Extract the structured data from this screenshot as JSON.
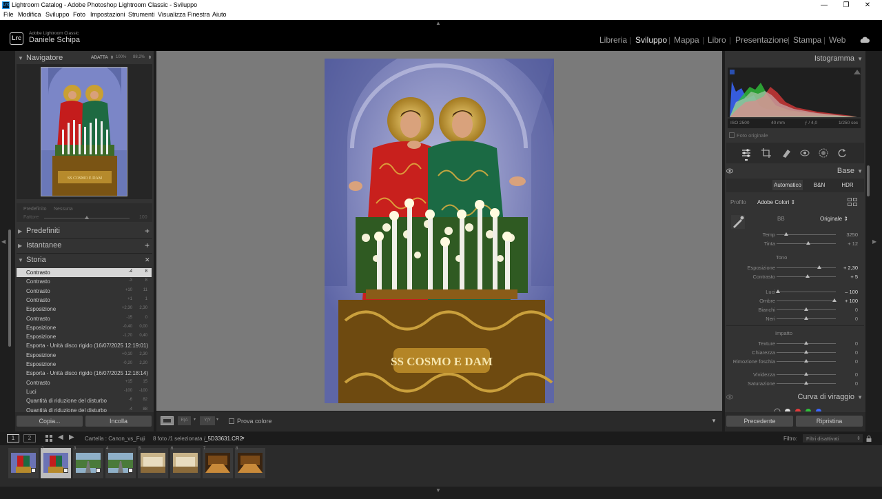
{
  "window": {
    "title": "Lightroom Catalog - Adobe Photoshop Lightroom Classic - Sviluppo",
    "app_icon": "Lrc",
    "controls": {
      "minimize": "—",
      "maximize": "❐",
      "close": "✕"
    }
  },
  "menu": [
    "File",
    "Modifica",
    "Sviluppo",
    "Foto",
    "Impostazioni",
    "Strumenti",
    "Visualizza",
    "Finestra",
    "Aiuto"
  ],
  "identity": {
    "logo": "Lrc",
    "product": "Adobe Lightroom Classic",
    "user": "Daniele Schipa"
  },
  "modules": [
    {
      "label": "Libreria",
      "active": false
    },
    {
      "label": "Sviluppo",
      "active": true
    },
    {
      "label": "Mappa",
      "active": false
    },
    {
      "label": "Libro",
      "active": false
    },
    {
      "label": "Presentazione",
      "active": false
    },
    {
      "label": "Stampa",
      "active": false
    },
    {
      "label": "Web",
      "active": false
    }
  ],
  "navigator": {
    "title": "Navigatore",
    "fit": "ADATTA",
    "z1": "100%",
    "z2": "88,2%"
  },
  "preset_amount": {
    "label": "Predefinito",
    "value": "Nessuna",
    "amount_label": "Fattore",
    "amount_value": "100",
    "amount": 0.5
  },
  "left_sections": {
    "presets": "Predefiniti",
    "snapshots": "Istantanee",
    "history": "Storia",
    "add": "+",
    "clear": "✕"
  },
  "history": [
    {
      "name": "Contrasto",
      "v1": "-4",
      "v2": "8",
      "selected": true
    },
    {
      "name": "Contrasto",
      "v1": "-3",
      "v2": "8"
    },
    {
      "name": "Contrasto",
      "v1": "+10",
      "v2": "11"
    },
    {
      "name": "Contrasto",
      "v1": "+1",
      "v2": "1"
    },
    {
      "name": "Esposizione",
      "v1": "+2,30",
      "v2": "2,30"
    },
    {
      "name": "Contrasto",
      "v1": "-15",
      "v2": "0"
    },
    {
      "name": "Esposizione",
      "v1": "-0,40",
      "v2": "0,00"
    },
    {
      "name": "Esposizione",
      "v1": "-1,70",
      "v2": "0,40"
    },
    {
      "name": "Esporta - Unità disco rigido (16/07/2025 12:19:01)",
      "v1": "",
      "v2": ""
    },
    {
      "name": "Esposizione",
      "v1": "+0,10",
      "v2": "2,30"
    },
    {
      "name": "Esposizione",
      "v1": "-0,20",
      "v2": "2,20"
    },
    {
      "name": "Esporta - Unità disco rigido (16/07/2025 12:18:14)",
      "v1": "",
      "v2": ""
    },
    {
      "name": "Contrasto",
      "v1": "+15",
      "v2": "15"
    },
    {
      "name": "Luci",
      "v1": "-100",
      "v2": "-100"
    },
    {
      "name": "Quantità di riduzione del disturbo",
      "v1": "-6",
      "v2": "82"
    },
    {
      "name": "Quantità di riduzione del disturbo",
      "v1": "-4",
      "v2": "88"
    }
  ],
  "left_buttons": {
    "copy": "Copia...",
    "paste": "Incolla"
  },
  "toolbar": {
    "soft_proof": "Prova colore",
    "view_ba": "R|A",
    "view_yy": "Y|Y"
  },
  "histogram": {
    "title": "Istogramma",
    "iso": "ISO 2500",
    "focal": "40 mm",
    "aperture": "ƒ / 4,0",
    "shutter": "1/250 sec",
    "original": "Foto originale"
  },
  "tools": [
    "sliders-icon",
    "crop-icon",
    "heal-icon",
    "redeye-icon",
    "mask-icon",
    "reset-icon"
  ],
  "base": {
    "title": "Base",
    "treatments": [
      "Automatico",
      "B&N",
      "HDR"
    ],
    "profile_label": "Profilo",
    "profile_value": "Adobe Colori ⇕",
    "wb_label": "BB",
    "wb_value": "Originale ⇕",
    "tone_label": "Tono",
    "presence_label": "Impatto"
  },
  "sliders_wb": [
    {
      "label": "Temp",
      "value": "3250",
      "pos": 0.16,
      "bright": false
    },
    {
      "label": "Tinta",
      "value": "+ 12",
      "pos": 0.54,
      "bright": false
    }
  ],
  "sliders_tone": [
    {
      "label": "Esposizione",
      "value": "+ 2,30",
      "pos": 0.72,
      "bright": true
    },
    {
      "label": "Contrasto",
      "value": "+ 5",
      "pos": 0.52,
      "bright": true
    },
    {
      "label": "Luci",
      "value": "– 100",
      "pos": 0.02,
      "bright": true
    },
    {
      "label": "Ombre",
      "value": "+ 100",
      "pos": 0.98,
      "bright": true
    },
    {
      "label": "Bianchi",
      "value": "0",
      "pos": 0.5,
      "bright": false
    },
    {
      "label": "Neri",
      "value": "0",
      "pos": 0.5,
      "bright": false
    }
  ],
  "sliders_presence": [
    {
      "label": "Texture",
      "value": "0",
      "pos": 0.5,
      "bright": false
    },
    {
      "label": "Chiarezza",
      "value": "0",
      "pos": 0.5,
      "bright": false
    },
    {
      "label": "Rimozione foschia",
      "value": "0",
      "pos": 0.5,
      "bright": false
    },
    {
      "label": "Vividezza",
      "value": "0",
      "pos": 0.5,
      "bright": false
    },
    {
      "label": "Saturazione",
      "value": "0",
      "pos": 0.5,
      "bright": false
    }
  ],
  "tone_curve": {
    "title": "Curva di viraggio"
  },
  "right_buttons": {
    "previous": "Precedente",
    "reset": "Ripristina"
  },
  "filmstrip_bar": {
    "screen1": "1",
    "screen2": "2",
    "source": "Cartella : Canon_vs_Fuji",
    "count": "8 foto /1 selezionata /",
    "filename": "_5D33631.CR2",
    "filter_label": "Filtro:",
    "filter_value": "Filtri disattivati"
  },
  "filmstrip": [
    {
      "num": "",
      "type": "saints",
      "selected": false
    },
    {
      "num": "2",
      "type": "saints",
      "selected": true
    },
    {
      "num": "3",
      "type": "road",
      "selected": false
    },
    {
      "num": "4",
      "type": "road",
      "selected": false
    },
    {
      "num": "5",
      "type": "room",
      "selected": false
    },
    {
      "num": "6",
      "type": "room",
      "selected": false
    },
    {
      "num": "7",
      "type": "warm",
      "selected": false
    },
    {
      "num": "8",
      "type": "warm",
      "selected": false
    }
  ],
  "colors": {
    "accent": "#31a8ff",
    "panel": "#333333",
    "bg": "#1e1e1e",
    "center": "#7a7a7a"
  }
}
